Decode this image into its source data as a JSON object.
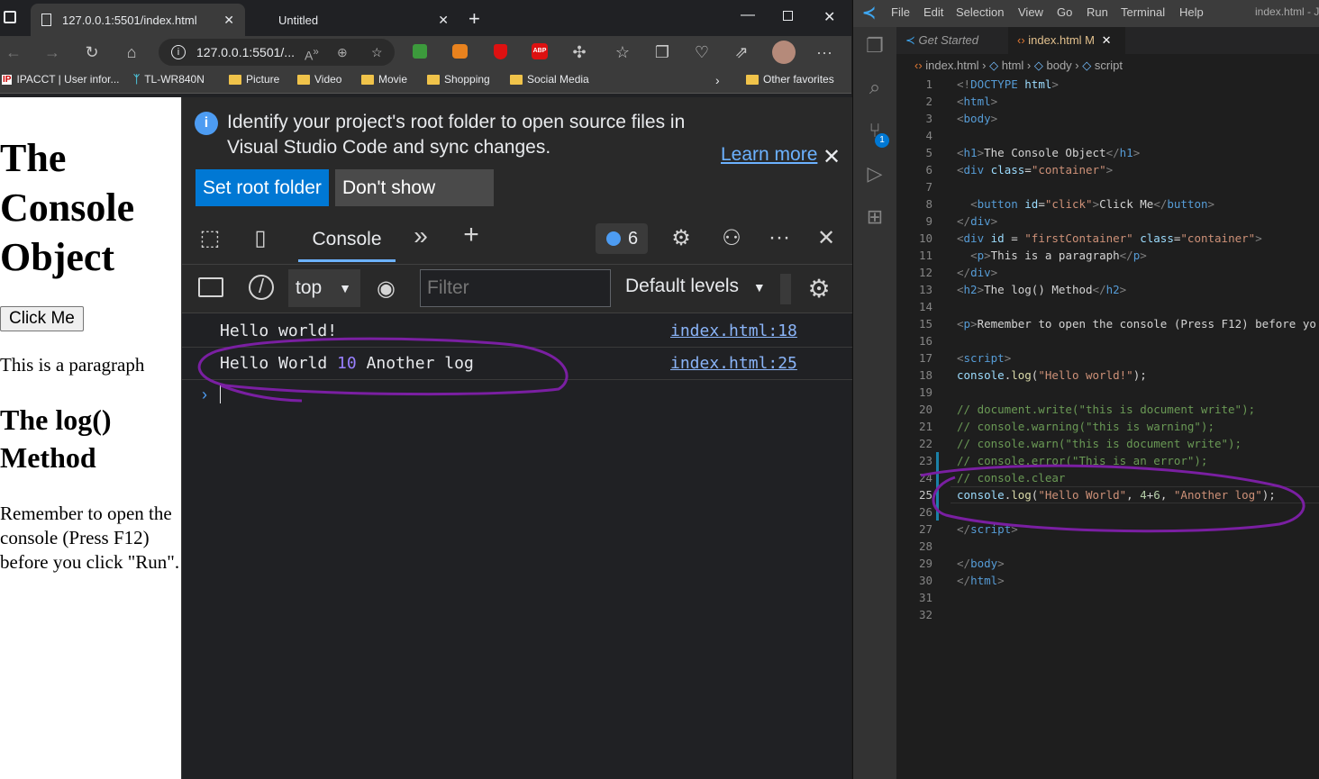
{
  "browser": {
    "tabs": [
      {
        "title": "127.0.0.1:5501/index.html",
        "active": true
      },
      {
        "title": "Untitled",
        "active": false
      }
    ],
    "address": "127.0.0.1:5501/...",
    "favorites": [
      "IPACCT | User infor...",
      "TL-WR840N",
      "Picture",
      "Video",
      "Movie",
      "Shopping",
      "Social Media"
    ],
    "other_favorites": "Other favorites"
  },
  "page": {
    "h1": "The Console Object",
    "button": "Click Me",
    "paragraph": "This is a paragraph",
    "h2": "The log() Method",
    "note": "Remember to open the console (Press F12) before you click \"Run\"."
  },
  "devtools": {
    "info_text": "Identify your project's root folder to open source files in Visual Studio Code and sync changes.",
    "learn_more": "Learn more",
    "set_root": "Set root folder",
    "dont_show": "Don't show again",
    "console_tab": "Console",
    "message_count": "6",
    "context": "top",
    "filter_placeholder": "Filter",
    "levels": "Default levels",
    "logs": [
      {
        "a": "Hello world!",
        "num": "",
        "b": "",
        "source": "index.html:18"
      },
      {
        "a": "Hello World ",
        "num": "10",
        "b": " Another log",
        "source": "index.html:25"
      }
    ]
  },
  "vscode": {
    "menu": [
      "File",
      "Edit",
      "Selection",
      "View",
      "Go",
      "Run",
      "Terminal",
      "Help"
    ],
    "title": "index.html - J",
    "tabs": [
      {
        "title": "Get Started"
      },
      {
        "title": "index.html",
        "badge": "M"
      }
    ],
    "breadcrumb": [
      "index.html",
      "html",
      "body",
      "script"
    ],
    "scm_badge": "1"
  },
  "colors": {
    "annotation": "#7a1fa2",
    "accent": "#0078d4"
  }
}
